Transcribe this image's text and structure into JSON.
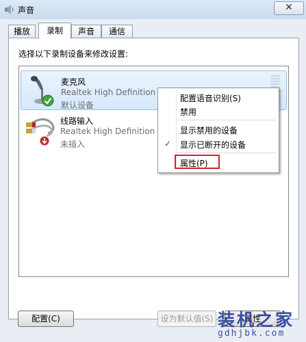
{
  "window": {
    "title": "声音",
    "close_glyph": "✕"
  },
  "tabs": [
    {
      "label": "播放",
      "active": false
    },
    {
      "label": "录制",
      "active": true
    },
    {
      "label": "声音",
      "active": false
    },
    {
      "label": "通信",
      "active": false
    }
  ],
  "instruction": "选择以下录制设备来修改设置:",
  "devices": [
    {
      "name": "麦克风",
      "driver": "Realtek High Definition Audio",
      "status": "默认设备",
      "icon": "microphone-icon",
      "badge": "default-check-icon",
      "selected": true
    },
    {
      "name": "线路输入",
      "driver": "Realtek High Definition Audio",
      "status": "未插入",
      "icon": "line-in-cable-icon",
      "badge": "unplugged-arrow-icon",
      "selected": false
    }
  ],
  "context_menu": {
    "items": [
      {
        "label": "配置语音识别(S)",
        "checked": false
      },
      {
        "label": "禁用",
        "checked": false
      },
      {
        "label": "显示禁用的设备",
        "checked": false
      },
      {
        "label": "显示已断开的设备",
        "checked": true
      },
      {
        "label": "属性(P)",
        "checked": false,
        "highlighted": true
      }
    ],
    "check_glyph": "✓"
  },
  "buttons": {
    "configure": "配置(C)",
    "set_default": "设为默认值(S)",
    "properties": "属性"
  },
  "watermark": {
    "main": "装机之家",
    "sub": "gdhjbk.com"
  },
  "colors": {
    "highlight_border": "#d2232a",
    "selected_bg": "#d6e8fb",
    "watermark": "#3a4ea0"
  }
}
